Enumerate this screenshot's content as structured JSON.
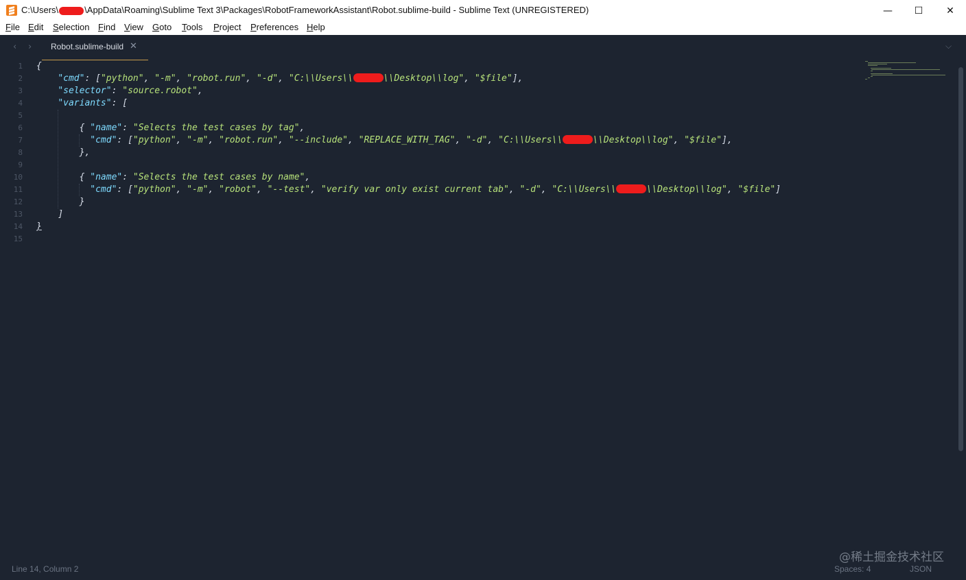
{
  "window": {
    "title_prefix": "C:\\Users\\",
    "title_suffix": "\\AppData\\Roaming\\Sublime Text 3\\Packages\\RobotFrameworkAssistant\\Robot.sublime-build - Sublime Text (UNREGISTERED)",
    "minimize": "—",
    "maximize": "☐",
    "close": "✕",
    "app_icon": "sublime-text-icon"
  },
  "menu": [
    {
      "key": "F",
      "rest": "ile"
    },
    {
      "key": "E",
      "rest": "dit"
    },
    {
      "key": "S",
      "rest": "election"
    },
    {
      "key": "F",
      "rest": "ind"
    },
    {
      "key": "V",
      "rest": "iew"
    },
    {
      "key": "G",
      "rest": "oto"
    },
    {
      "key": "T",
      "rest": "ools"
    },
    {
      "key": "P",
      "rest": "roject"
    },
    {
      "key": "P",
      "rest": "references",
      "pre": ""
    },
    {
      "key": "H",
      "rest": "elp"
    }
  ],
  "tabbar": {
    "nav_back": "‹",
    "nav_forward": "›",
    "tab_label": "Robot.sublime-build",
    "tab_close": "✕",
    "dropdown": "⌵"
  },
  "line_numbers": [
    "1",
    "2",
    "3",
    "4",
    "5",
    "6",
    "7",
    "8",
    "9",
    "10",
    "11",
    "12",
    "13",
    "14",
    "15"
  ],
  "code": {
    "l1": "{",
    "l2_key": "\"cmd\"",
    "l2_a": ": [",
    "l2_s1": "\"python\"",
    "l2_s2": "\"-m\"",
    "l2_s3": "\"robot.run\"",
    "l2_s4": "\"-d\"",
    "l2_s5a": "\"C:\\\\Users\\\\",
    "l2_s5b": "\\\\Desktop\\\\log\"",
    "l2_s6": "\"$file\"",
    "l2_end": "],",
    "l3_key": "\"selector\"",
    "l3_val": "\"source.robot\"",
    "l4_key": "\"variants\"",
    "l4_end": ": [",
    "l6_open": "{ ",
    "l6_key": "\"name\"",
    "l6_val": "\"Selects the test cases by tag\"",
    "l7_key": "\"cmd\"",
    "l7_s1": "\"python\"",
    "l7_s2": "\"-m\"",
    "l7_s3": "\"robot.run\"",
    "l7_s4": "\"--include\"",
    "l7_s5": "\"REPLACE_WITH_TAG\"",
    "l7_s6": "\"-d\"",
    "l7_s7a": "\"C:\\\\Users\\\\",
    "l7_s7b": "\\\\Desktop\\\\log\"",
    "l7_s8": "\"$file\"",
    "l7_end": "],",
    "l8": "},",
    "l10_open": "{ ",
    "l10_key": "\"name\"",
    "l10_val": "\"Selects the test cases by name\"",
    "l11_key": "\"cmd\"",
    "l11_s1": "\"python\"",
    "l11_s2": "\"-m\"",
    "l11_s3": "\"robot\"",
    "l11_s4": "\"--test\"",
    "l11_s5": "\"verify var only exist current tab\"",
    "l11_s6": "\"-d\"",
    "l11_s7a": "\"C:\\\\Users\\\\",
    "l11_s7b": "\\\\Desktop\\\\log\"",
    "l11_s8": "\"$file\"",
    "l11_end": "]",
    "l12": "}",
    "l13": "]",
    "l14": "}"
  },
  "status": {
    "position": "Line 14, Column 2",
    "spaces": "Spaces: 4",
    "syntax": "JSON",
    "watermark": "@稀土掘金技术社区"
  },
  "colors": {
    "background": "#1d2430",
    "key": "#7fdbff",
    "string": "#b7e27a",
    "tab_underline": "#c89b4b",
    "redaction": "#ee1c1c"
  }
}
